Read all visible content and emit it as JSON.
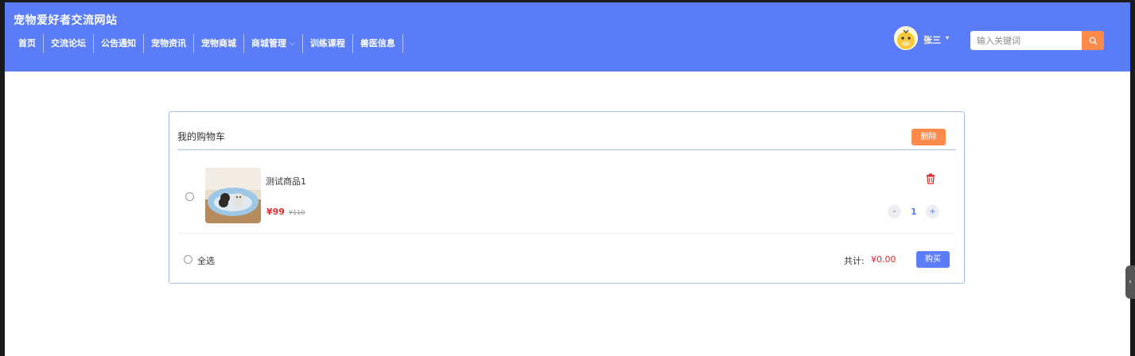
{
  "header": {
    "site_title": "宠物爱好者交流网站",
    "nav": [
      "首页",
      "交流论坛",
      "公告通知",
      "宠物资讯",
      "宠物商城",
      "商城管理",
      "训练课程",
      "兽医信息"
    ],
    "dropdown_caret": "⌵",
    "user_name": "张三",
    "user_caret": "▾",
    "search_placeholder": "输入关键词",
    "accent_color": "#5a7df7",
    "search_button_color": "#ff8a4c"
  },
  "cart": {
    "title": "我的购物车",
    "delete_label": "删除",
    "items": [
      {
        "name": "测试商品1",
        "price": "¥99",
        "original_price": "¥110",
        "quantity": "1",
        "minus": "-",
        "plus": "+"
      }
    ],
    "select_all_label": "全选",
    "total_label": "共计:",
    "total_value": "¥0.00",
    "buy_label": "购买",
    "price_color": "#e8292f"
  },
  "icons": {
    "search": "search-icon",
    "trash": "trash-icon",
    "avatar": "avatar-image",
    "side_tab": "chevron-left-icon"
  },
  "side_tab_glyph": "‹"
}
